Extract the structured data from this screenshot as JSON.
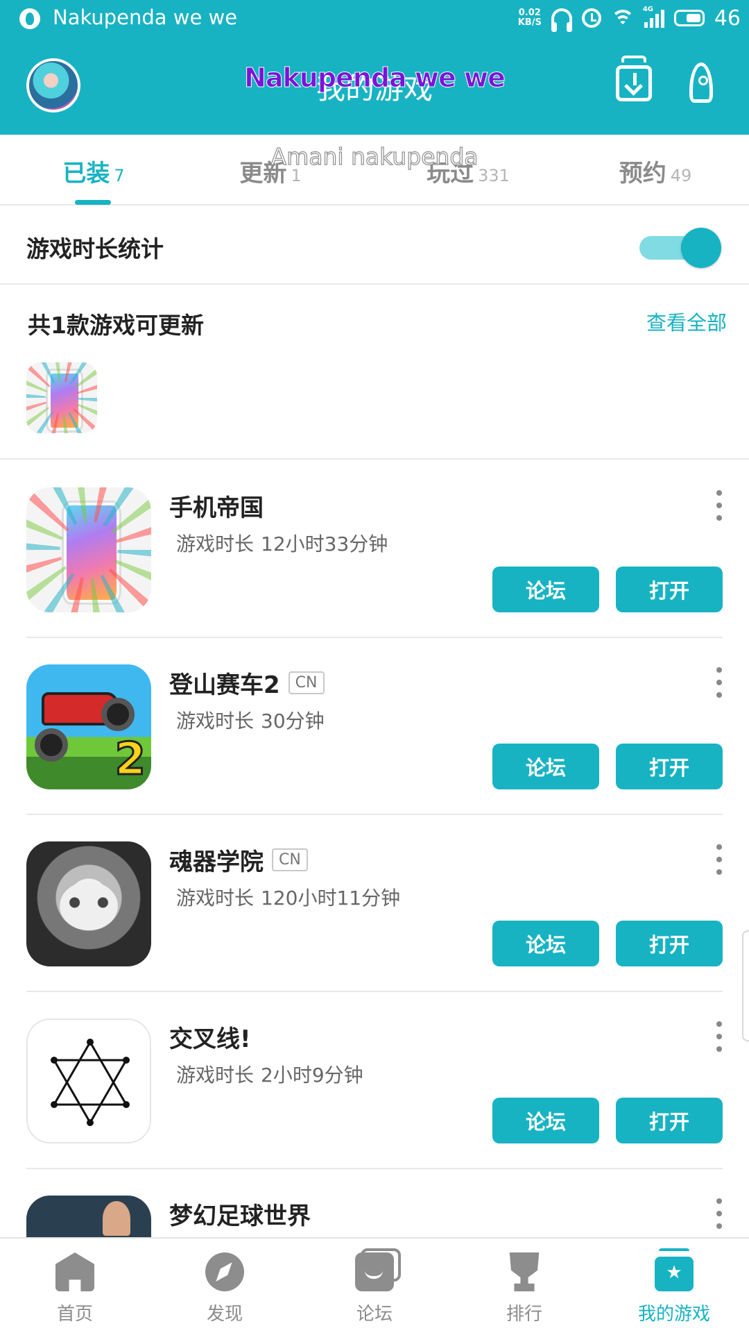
{
  "status_bar": {
    "song": "Nakupenda we we",
    "net_speed_value": "0.02",
    "net_speed_unit": "KB/S",
    "network_type": "4G",
    "battery": "46"
  },
  "header": {
    "title": "我的游戏",
    "overlay_lyric_1": "Nakupenda we we",
    "overlay_lyric_2": "Amani nakupenda"
  },
  "tabs": [
    {
      "label": "已装",
      "count": "7",
      "active": true
    },
    {
      "label": "更新",
      "count": "1",
      "active": false
    },
    {
      "label": "玩过",
      "count": "331",
      "active": false
    },
    {
      "label": "预约",
      "count": "49",
      "active": false
    }
  ],
  "toggle": {
    "label": "游戏时长统计",
    "on": true
  },
  "updates": {
    "title": "共1款游戏可更新",
    "view_all": "查看全部"
  },
  "games": [
    {
      "name": "手机帝国",
      "badge": "",
      "time_label": "游戏时长",
      "time_value": "12小时33分钟",
      "forum": "论坛",
      "open": "打开"
    },
    {
      "name": "登山赛车2",
      "badge": "CN",
      "time_label": "游戏时长",
      "time_value": "30分钟",
      "forum": "论坛",
      "open": "打开"
    },
    {
      "name": "魂器学院",
      "badge": "CN",
      "time_label": "游戏时长",
      "time_value": "120小时11分钟",
      "forum": "论坛",
      "open": "打开"
    },
    {
      "name": "交叉线!",
      "badge": "",
      "time_label": "游戏时长",
      "time_value": "2小时9分钟",
      "forum": "论坛",
      "open": "打开"
    },
    {
      "name": "梦幻足球世界",
      "badge": "",
      "time_label": "",
      "time_value": "",
      "forum": "",
      "open": ""
    }
  ],
  "race_icon_number": "2",
  "bottom_nav": [
    {
      "label": "首页",
      "icon": "home-icon"
    },
    {
      "label": "发现",
      "icon": "compass-icon"
    },
    {
      "label": "论坛",
      "icon": "chat-icon"
    },
    {
      "label": "排行",
      "icon": "trophy-icon"
    },
    {
      "label": "我的游戏",
      "icon": "my-games-icon",
      "active": true
    }
  ],
  "colors": {
    "accent": "#17b3c3",
    "overlay_purple": "#7b13d8"
  }
}
